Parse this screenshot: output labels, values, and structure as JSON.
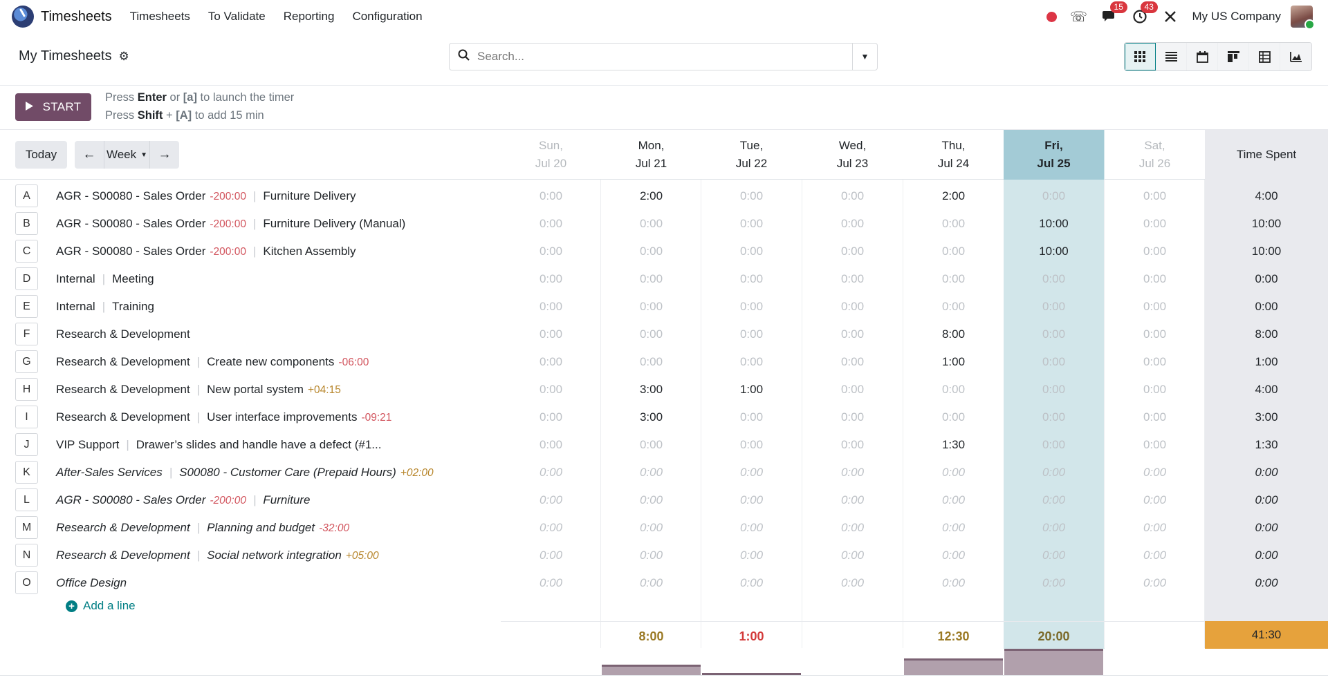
{
  "navbar": {
    "app_title": "Timesheets",
    "menu": [
      "Timesheets",
      "To Validate",
      "Reporting",
      "Configuration"
    ],
    "messages_badge": "15",
    "activities_badge": "43",
    "company": "My US Company"
  },
  "control_panel": {
    "title": "My Timesheets",
    "search_placeholder": "Search...",
    "views": [
      "grid",
      "list",
      "calendar",
      "kanban",
      "pivot",
      "graph"
    ]
  },
  "timer": {
    "start_label": "START",
    "hint1": {
      "a": "Press ",
      "b": "Enter",
      "c": " or ",
      "d": "[a]",
      "e": " to launch the timer"
    },
    "hint2": {
      "a": "Press ",
      "b": "Shift",
      "c": " + ",
      "d": "[A]",
      "e": " to add 15 min"
    }
  },
  "grid": {
    "today_label": "Today",
    "range_label": "Week",
    "days": [
      {
        "d": "Sun,",
        "date": "Jul 20"
      },
      {
        "d": "Mon,",
        "date": "Jul 21"
      },
      {
        "d": "Tue,",
        "date": "Jul 22"
      },
      {
        "d": "Wed,",
        "date": "Jul 23"
      },
      {
        "d": "Thu,",
        "date": "Jul 24"
      },
      {
        "d": "Fri,",
        "date": "Jul 25"
      },
      {
        "d": "Sat,",
        "date": "Jul 26"
      }
    ],
    "time_spent_label": "Time Spent",
    "rows": [
      {
        "letter": "A",
        "project": "AGR - S00080 - Sales Order",
        "project_delta": "-200:00",
        "task": "Furniture Delivery",
        "task_delta": "",
        "cells": [
          "0:00",
          "2:00",
          "0:00",
          "0:00",
          "2:00",
          "0:00",
          "0:00"
        ],
        "total": "4:00",
        "italic": false
      },
      {
        "letter": "B",
        "project": "AGR - S00080 - Sales Order",
        "project_delta": "-200:00",
        "task": "Furniture Delivery (Manual)",
        "task_delta": "",
        "cells": [
          "0:00",
          "0:00",
          "0:00",
          "0:00",
          "0:00",
          "10:00",
          "0:00"
        ],
        "total": "10:00",
        "italic": false
      },
      {
        "letter": "C",
        "project": "AGR - S00080 - Sales Order",
        "project_delta": "-200:00",
        "task": "Kitchen Assembly",
        "task_delta": "",
        "cells": [
          "0:00",
          "0:00",
          "0:00",
          "0:00",
          "0:00",
          "10:00",
          "0:00"
        ],
        "total": "10:00",
        "italic": false
      },
      {
        "letter": "D",
        "project": "Internal",
        "project_delta": "",
        "task": "Meeting",
        "task_delta": "",
        "cells": [
          "0:00",
          "0:00",
          "0:00",
          "0:00",
          "0:00",
          "0:00",
          "0:00"
        ],
        "total": "0:00",
        "italic": false
      },
      {
        "letter": "E",
        "project": "Internal",
        "project_delta": "",
        "task": "Training",
        "task_delta": "",
        "cells": [
          "0:00",
          "0:00",
          "0:00",
          "0:00",
          "0:00",
          "0:00",
          "0:00"
        ],
        "total": "0:00",
        "italic": false
      },
      {
        "letter": "F",
        "project": "Research & Development",
        "project_delta": "",
        "task": "",
        "task_delta": "",
        "cells": [
          "0:00",
          "0:00",
          "0:00",
          "0:00",
          "8:00",
          "0:00",
          "0:00"
        ],
        "total": "8:00",
        "italic": false
      },
      {
        "letter": "G",
        "project": "Research & Development",
        "project_delta": "",
        "task": "Create new components",
        "task_delta": "-06:00",
        "cells": [
          "0:00",
          "0:00",
          "0:00",
          "0:00",
          "1:00",
          "0:00",
          "0:00"
        ],
        "total": "1:00",
        "italic": false
      },
      {
        "letter": "H",
        "project": "Research & Development",
        "project_delta": "",
        "task": "New portal system",
        "task_delta": "+04:15",
        "cells": [
          "0:00",
          "3:00",
          "1:00",
          "0:00",
          "0:00",
          "0:00",
          "0:00"
        ],
        "total": "4:00",
        "italic": false
      },
      {
        "letter": "I",
        "project": "Research & Development",
        "project_delta": "",
        "task": "User interface improvements",
        "task_delta": "-09:21",
        "cells": [
          "0:00",
          "3:00",
          "0:00",
          "0:00",
          "0:00",
          "0:00",
          "0:00"
        ],
        "total": "3:00",
        "italic": false
      },
      {
        "letter": "J",
        "project": "VIP Support",
        "project_delta": "",
        "task": "Drawer’s slides and handle have a defect (#1...",
        "task_delta": "",
        "cells": [
          "0:00",
          "0:00",
          "0:00",
          "0:00",
          "1:30",
          "0:00",
          "0:00"
        ],
        "total": "1:30",
        "italic": false
      },
      {
        "letter": "K",
        "project": "After-Sales Services",
        "project_delta": "",
        "task": "S00080 - Customer Care (Prepaid Hours)",
        "task_delta": "+02:00",
        "cells": [
          "0:00",
          "0:00",
          "0:00",
          "0:00",
          "0:00",
          "0:00",
          "0:00"
        ],
        "total": "0:00",
        "italic": true
      },
      {
        "letter": "L",
        "project": "AGR - S00080 - Sales Order",
        "project_delta": "-200:00",
        "task": "Furniture",
        "task_delta": "",
        "cells": [
          "0:00",
          "0:00",
          "0:00",
          "0:00",
          "0:00",
          "0:00",
          "0:00"
        ],
        "total": "0:00",
        "italic": true
      },
      {
        "letter": "M",
        "project": "Research & Development",
        "project_delta": "",
        "task": "Planning and budget",
        "task_delta": "-32:00",
        "cells": [
          "0:00",
          "0:00",
          "0:00",
          "0:00",
          "0:00",
          "0:00",
          "0:00"
        ],
        "total": "0:00",
        "italic": true
      },
      {
        "letter": "N",
        "project": "Research & Development",
        "project_delta": "",
        "task": "Social network integration",
        "task_delta": "+05:00",
        "cells": [
          "0:00",
          "0:00",
          "0:00",
          "0:00",
          "0:00",
          "0:00",
          "0:00"
        ],
        "total": "0:00",
        "italic": true
      },
      {
        "letter": "O",
        "project": "Office Design",
        "project_delta": "",
        "task": "",
        "task_delta": "",
        "cells": [
          "0:00",
          "0:00",
          "0:00",
          "0:00",
          "0:00",
          "0:00",
          "0:00"
        ],
        "total": "0:00",
        "italic": true
      }
    ],
    "add_line_label": "Add a line",
    "day_totals": [
      "",
      "8:00",
      "1:00",
      "",
      "12:30",
      "20:00",
      ""
    ],
    "grand_total": "41:30",
    "colors": {
      "accent": "#017e84",
      "start": "#714b67",
      "today": "#d2e6ea",
      "total": "#e6a23c"
    }
  }
}
